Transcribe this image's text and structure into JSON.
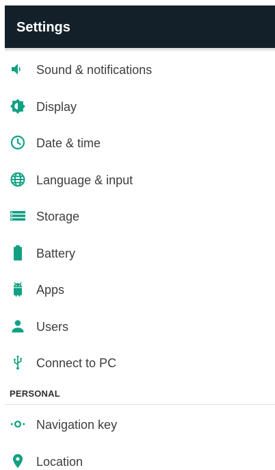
{
  "app_bar": {
    "title": "Settings"
  },
  "colors": {
    "app_bar": "#13202a",
    "accent": "#11a083",
    "text": "#3d3d3d"
  },
  "settings_list": {
    "items": [
      {
        "label": "Sound & notifications",
        "icon": "volume-icon"
      },
      {
        "label": "Display",
        "icon": "brightness-icon"
      },
      {
        "label": "Date & time",
        "icon": "clock-icon"
      },
      {
        "label": "Language & input",
        "icon": "globe-icon"
      },
      {
        "label": "Storage",
        "icon": "storage-icon"
      },
      {
        "label": "Battery",
        "icon": "battery-icon"
      },
      {
        "label": "Apps",
        "icon": "android-icon"
      },
      {
        "label": "Users",
        "icon": "person-icon"
      },
      {
        "label": "Connect to PC",
        "icon": "usb-icon"
      }
    ]
  },
  "personal_section": {
    "header": "PERSONAL",
    "items": [
      {
        "label": "Navigation key",
        "icon": "navigation-key-icon"
      },
      {
        "label": "Location",
        "icon": "location-pin-icon"
      }
    ]
  }
}
